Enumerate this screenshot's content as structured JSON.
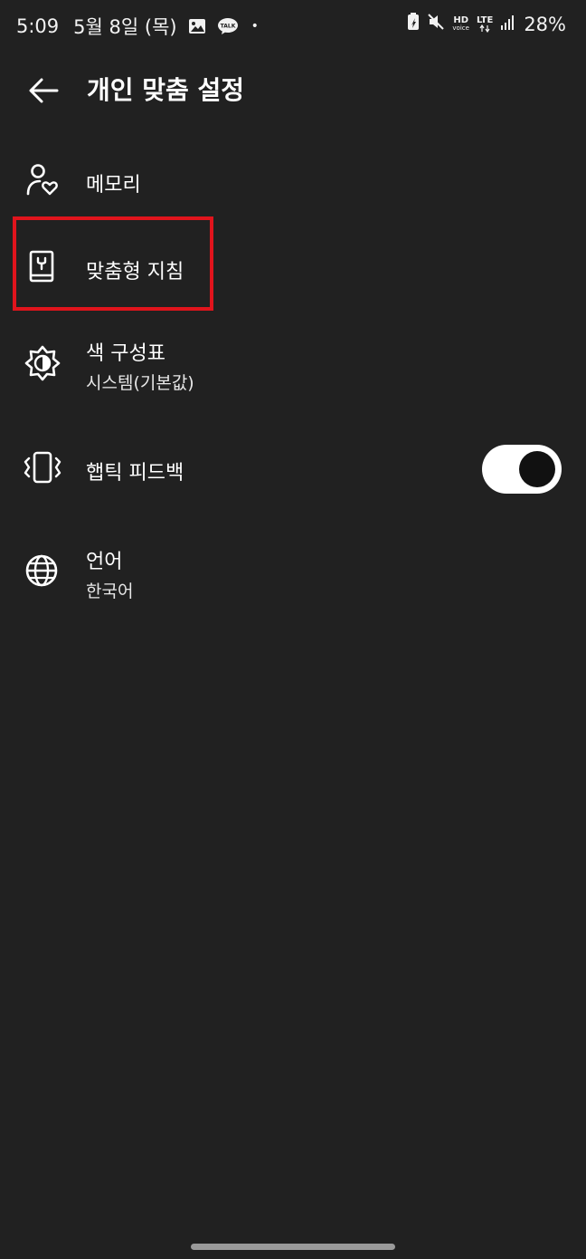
{
  "status_bar": {
    "time": "5:09",
    "date": "5월 8일 (목)",
    "gallery_icon": "image-icon",
    "talk_icon": "kakaotalk-icon",
    "talk_label": "TALK",
    "dot": "•",
    "battery_saver_icon": "battery-saver-icon",
    "mute_icon": "mute-icon",
    "hd_label": "HD",
    "hd_sub": "voice",
    "lte_label": "LTE",
    "signal_icon": "signal-icon",
    "battery_percent": "28%"
  },
  "appbar": {
    "back_icon": "arrow-left-icon",
    "title": "개인 맞춤 설정"
  },
  "settings": {
    "memory": {
      "icon": "user-heart-icon",
      "label": "메모리"
    },
    "custom_instructions": {
      "icon": "book-icon",
      "label": "맞춤형 지침"
    },
    "color_scheme": {
      "icon": "brightness-icon",
      "label": "색 구성표",
      "value": "시스템(기본값)"
    },
    "haptic_feedback": {
      "icon": "vibrate-icon",
      "label": "햅틱 피드백",
      "enabled": true
    },
    "language": {
      "icon": "globe-icon",
      "label": "언어",
      "value": "한국어"
    }
  },
  "colors": {
    "background": "#212121",
    "text": "#ffffff",
    "highlight_border": "#e0141c",
    "toggle_track": "#ffffff",
    "toggle_knob": "#111111"
  }
}
